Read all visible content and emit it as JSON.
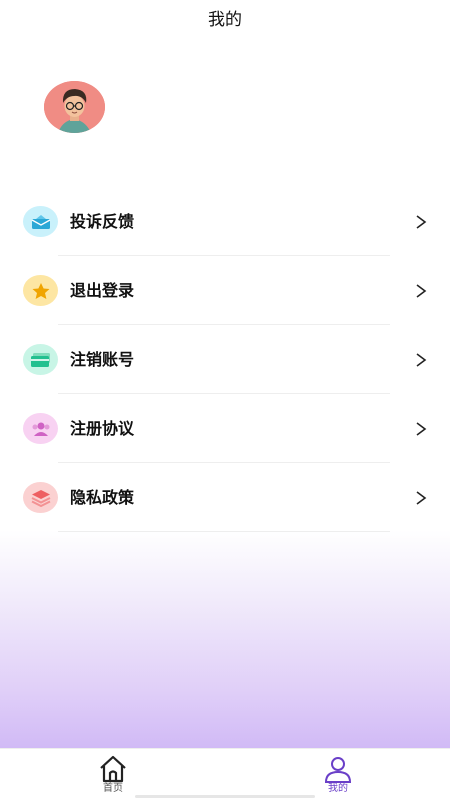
{
  "header": {
    "title": "我的"
  },
  "menu": {
    "items": [
      {
        "label": "投诉反馈",
        "icon": "envelope-icon",
        "bg": "#c9f1fb",
        "fg": "#2aa8d6"
      },
      {
        "label": "退出登录",
        "icon": "star-icon",
        "bg": "#fde6a3",
        "fg": "#f0a400"
      },
      {
        "label": "注销账号",
        "icon": "card-icon",
        "bg": "#c8f5e6",
        "fg": "#22c08f"
      },
      {
        "label": "注册协议",
        "icon": "users-icon",
        "bg": "#f8d2f2",
        "fg": "#cf62c4"
      },
      {
        "label": "隐私政策",
        "icon": "layers-icon",
        "bg": "#fbd1d1",
        "fg": "#ee5f62"
      }
    ]
  },
  "tabbar": {
    "tabs": [
      {
        "label": "首页",
        "icon": "home-icon",
        "active": false,
        "color": "#555555"
      },
      {
        "label": "我的",
        "icon": "user-icon",
        "active": true,
        "color": "#6a3fc8"
      }
    ]
  },
  "colors": {
    "accent": "#6a3fc8",
    "gradient_bottom": "#d1baf6"
  }
}
